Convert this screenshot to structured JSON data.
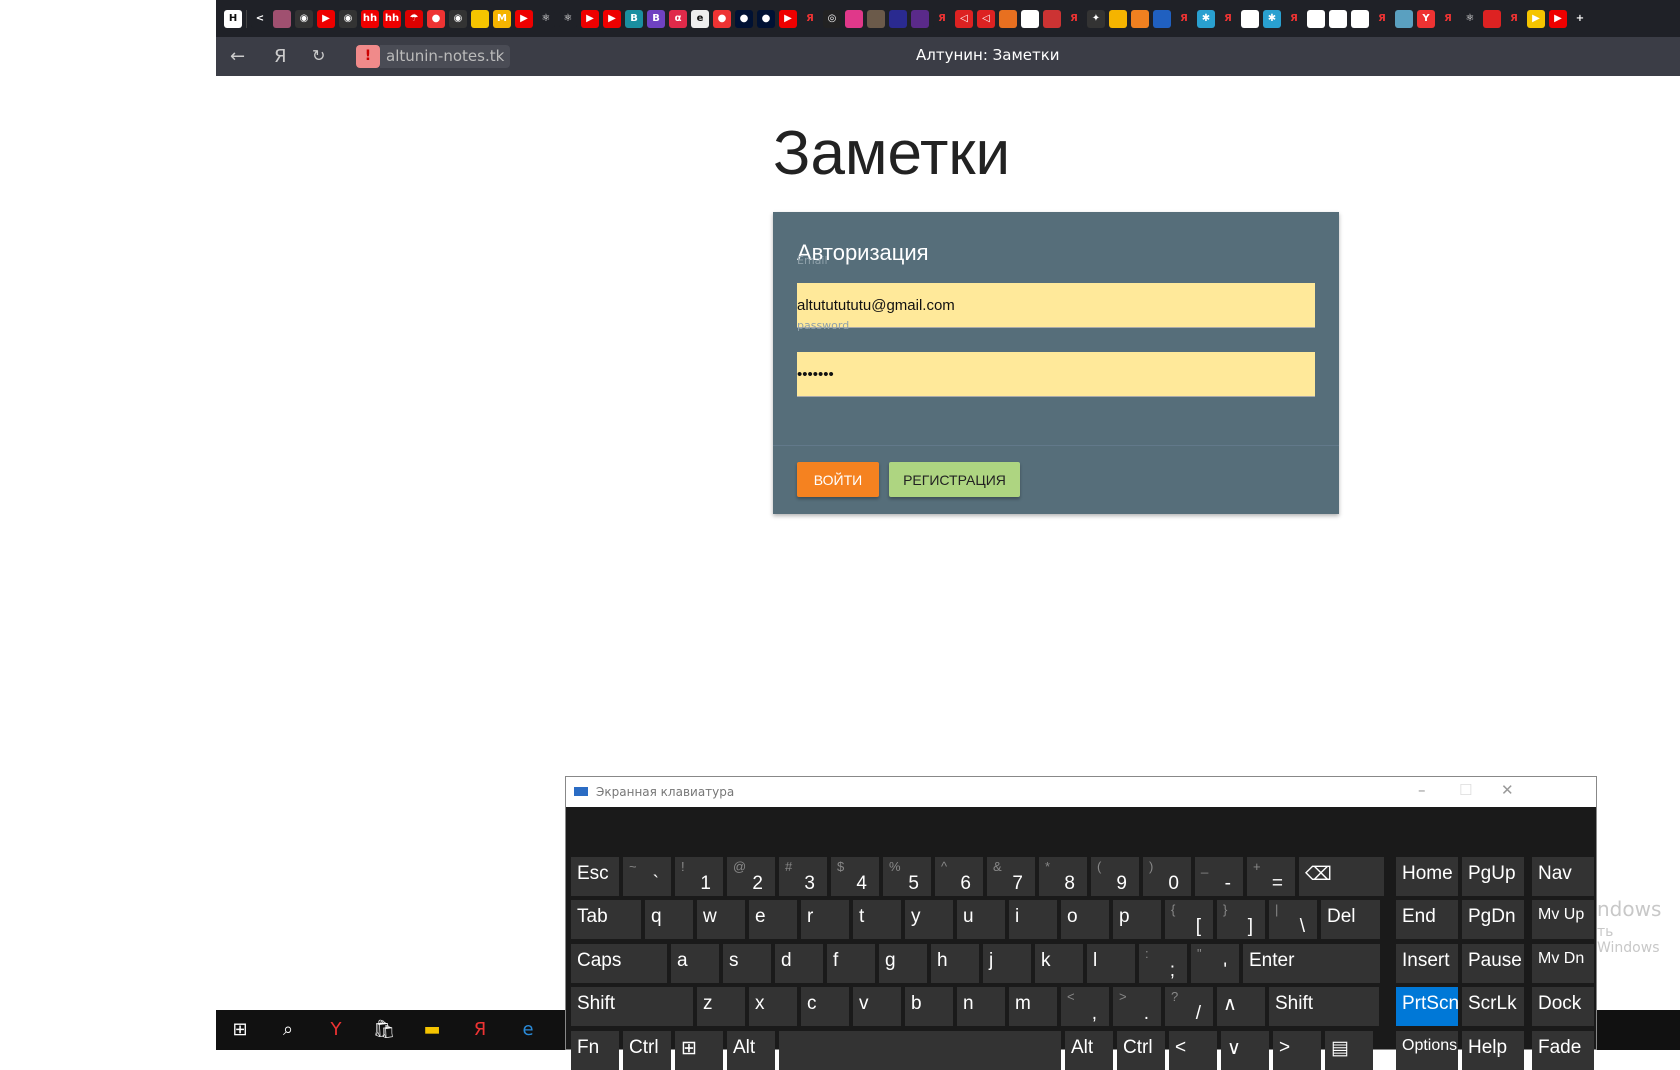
{
  "browser": {
    "tabs": [
      {
        "icon": "h-logo",
        "color": "#ffffff",
        "text": "H"
      },
      {
        "icon": "back-arrow",
        "color": "#1f2127",
        "text": "<"
      },
      {
        "icon": "soundwave",
        "color": "#a05070",
        "text": ""
      },
      {
        "icon": "github",
        "color": "#333",
        "text": "◉"
      },
      {
        "icon": "youtube",
        "color": "#e00",
        "text": "▶"
      },
      {
        "icon": "github",
        "color": "#333",
        "text": "◉"
      },
      {
        "icon": "hh",
        "color": "#e00",
        "text": "hh"
      },
      {
        "icon": "hh",
        "color": "#e00",
        "text": "hh"
      },
      {
        "icon": "umbrella",
        "color": "#d00",
        "text": "☂"
      },
      {
        "icon": "map-pin",
        "color": "#e33",
        "text": "●"
      },
      {
        "icon": "github",
        "color": "#333",
        "text": "◉"
      },
      {
        "icon": "yellow-doc",
        "color": "#f5c400",
        "text": ""
      },
      {
        "icon": "gmail",
        "color": "#f5b400",
        "text": "M"
      },
      {
        "icon": "youtube",
        "color": "#e00",
        "text": "▶"
      },
      {
        "icon": "react",
        "color": "#1f2127",
        "text": "⚛"
      },
      {
        "icon": "react",
        "color": "#1f2127",
        "text": "⚛"
      },
      {
        "icon": "youtube",
        "color": "#e00",
        "text": "▶"
      },
      {
        "icon": "youtube",
        "color": "#e00",
        "text": "▶"
      },
      {
        "icon": "react-b",
        "color": "#1a8fa0",
        "text": "B"
      },
      {
        "icon": "bootstrap",
        "color": "#6f42c1",
        "text": "B"
      },
      {
        "icon": "alpha",
        "color": "#e02a4a",
        "text": "α"
      },
      {
        "icon": "pdf",
        "color": "#eee",
        "text": "e"
      },
      {
        "icon": "map-pin",
        "color": "#e33",
        "text": "●"
      },
      {
        "icon": "pin-blue",
        "color": "#013",
        "text": "●"
      },
      {
        "icon": "pin-blue",
        "color": "#013",
        "text": "●"
      },
      {
        "icon": "youtube",
        "color": "#e00",
        "text": "▶"
      },
      {
        "icon": "yandex",
        "color": "#1f2127",
        "text": "Я"
      },
      {
        "icon": "target",
        "color": "#222",
        "text": "◎"
      },
      {
        "icon": "pink-dot",
        "color": "#e0388a",
        "text": ""
      },
      {
        "icon": "cube",
        "color": "#6b5a4a",
        "text": ""
      },
      {
        "icon": "circle-blue",
        "color": "#2a2a90",
        "text": ""
      },
      {
        "icon": "maff",
        "color": "#5a2a8a",
        "text": ""
      },
      {
        "icon": "yandex",
        "color": "#1f2127",
        "text": "Я"
      },
      {
        "icon": "triangle-red",
        "color": "#d22",
        "text": "◁"
      },
      {
        "icon": "triangle-red",
        "color": "#d22",
        "text": "◁"
      },
      {
        "icon": "fox",
        "color": "#e87020",
        "text": ""
      },
      {
        "icon": "doc",
        "color": "#fff",
        "text": ""
      },
      {
        "icon": "rocket",
        "color": "#c33",
        "text": ""
      },
      {
        "icon": "yandex",
        "color": "#1f2127",
        "text": "Я"
      },
      {
        "icon": "sparkle",
        "color": "#333",
        "text": "✦"
      },
      {
        "icon": "chart",
        "color": "#f5b400",
        "text": ""
      },
      {
        "icon": "ok",
        "color": "#f08020",
        "text": ""
      },
      {
        "icon": "wave",
        "color": "#2060c0",
        "text": ""
      },
      {
        "icon": "yandex",
        "color": "#1f2127",
        "text": "Я"
      },
      {
        "icon": "snowflake",
        "color": "#29a0d0",
        "text": "✱"
      },
      {
        "icon": "yandex",
        "color": "#1f2127",
        "text": "Я"
      },
      {
        "icon": "pause",
        "color": "#fff",
        "text": ""
      },
      {
        "icon": "snowflake",
        "color": "#29a0d0",
        "text": "✱"
      },
      {
        "icon": "yandex",
        "color": "#1f2127",
        "text": "Я"
      },
      {
        "icon": "doc",
        "color": "#fff",
        "text": ""
      },
      {
        "icon": "doc",
        "color": "#fff",
        "text": ""
      },
      {
        "icon": "white-circle",
        "color": "#fff",
        "text": ""
      },
      {
        "icon": "yandex",
        "color": "#1f2127",
        "text": "Я"
      },
      {
        "icon": "soundwave",
        "color": "#5aa0c0",
        "text": ""
      },
      {
        "icon": "yandex-browser",
        "color": "#e33",
        "text": "Y"
      },
      {
        "icon": "yandex",
        "color": "#1f2127",
        "text": "Я"
      },
      {
        "icon": "react",
        "color": "#1f2127",
        "text": "⚛"
      },
      {
        "icon": "red-book",
        "color": "#d22",
        "text": ""
      },
      {
        "icon": "yandex",
        "color": "#1f2127",
        "text": "Я"
      },
      {
        "icon": "play-yellow",
        "color": "#f5c400",
        "text": "▶"
      },
      {
        "icon": "youtube",
        "color": "#e00",
        "text": "▶"
      },
      {
        "icon": "new-tab-plus",
        "color": "#1f2127",
        "text": "+"
      }
    ],
    "url": "altunin-notes.tk",
    "page_title": "Алтунин: Заметки",
    "warning_icon": "!"
  },
  "page": {
    "title": "Заметки",
    "card": {
      "heading": "Авторизация",
      "email_label": "Email",
      "email_value": "altututututu@gmail.com",
      "password_label": "password",
      "password_value": "1234567",
      "login_button": "ВОЙТИ",
      "register_button": "РЕГИСТРАЦИЯ"
    }
  },
  "osk": {
    "title": "Экранная клавиатура",
    "rows": [
      [
        [
          "Esc",
          ""
        ],
        [
          "`",
          "~"
        ],
        [
          "1",
          "!"
        ],
        [
          "2",
          "@"
        ],
        [
          "3",
          "#"
        ],
        [
          "4",
          "$"
        ],
        [
          "5",
          "%"
        ],
        [
          "6",
          "^"
        ],
        [
          "7",
          "&"
        ],
        [
          "8",
          "*"
        ],
        [
          "9",
          "("
        ],
        [
          "0",
          ")"
        ],
        [
          "-",
          "_"
        ],
        [
          "=",
          "+"
        ],
        [
          "⌫",
          ""
        ]
      ],
      [
        [
          "Tab",
          ""
        ],
        [
          "q",
          ""
        ],
        [
          "w",
          ""
        ],
        [
          "e",
          ""
        ],
        [
          "r",
          ""
        ],
        [
          "t",
          ""
        ],
        [
          "y",
          ""
        ],
        [
          "u",
          ""
        ],
        [
          "i",
          ""
        ],
        [
          "o",
          ""
        ],
        [
          "p",
          ""
        ],
        [
          "[",
          "{"
        ],
        [
          "]",
          "}"
        ],
        [
          "\\",
          "|"
        ],
        [
          "Del",
          ""
        ]
      ],
      [
        [
          "Caps",
          ""
        ],
        [
          "a",
          ""
        ],
        [
          "s",
          ""
        ],
        [
          "d",
          ""
        ],
        [
          "f",
          ""
        ],
        [
          "g",
          ""
        ],
        [
          "h",
          ""
        ],
        [
          "j",
          ""
        ],
        [
          "k",
          ""
        ],
        [
          "l",
          ""
        ],
        [
          ";",
          ":"
        ],
        [
          "'",
          "\""
        ],
        [
          "Enter",
          ""
        ]
      ],
      [
        [
          "Shift",
          ""
        ],
        [
          "z",
          ""
        ],
        [
          "x",
          ""
        ],
        [
          "c",
          ""
        ],
        [
          "v",
          ""
        ],
        [
          "b",
          ""
        ],
        [
          "n",
          ""
        ],
        [
          "m",
          ""
        ],
        [
          ",",
          "<"
        ],
        [
          ".",
          ">"
        ],
        [
          "/",
          "?"
        ],
        [
          "∧",
          ""
        ],
        [
          "Shift",
          ""
        ]
      ],
      [
        [
          "Fn",
          ""
        ],
        [
          "Ctrl",
          ""
        ],
        [
          "⊞",
          ""
        ],
        [
          "Alt",
          ""
        ],
        [
          "",
          ""
        ],
        [
          "Alt",
          ""
        ],
        [
          "Ctrl",
          ""
        ],
        [
          "<",
          ""
        ],
        [
          "∨",
          ""
        ],
        [
          ">",
          ""
        ],
        [
          "▤",
          ""
        ]
      ]
    ],
    "nav": [
      [
        "Home",
        "PgUp",
        "Nav"
      ],
      [
        "End",
        "PgDn",
        "Mv Up"
      ],
      [
        "Insert",
        "Pause",
        "Mv Dn"
      ],
      [
        "PrtScn",
        "ScrLk",
        "Dock"
      ],
      [
        "Options",
        "Help",
        "Fade"
      ]
    ],
    "highlighted_key": "PrtScn",
    "highlight_color": "#0078d7"
  },
  "watermark": {
    "line1": "ndows",
    "line2": "ть Windows"
  },
  "taskbar": {
    "icons": [
      "start-icon",
      "search-icon",
      "yandex-browser-icon",
      "store-icon",
      "explorer-icon",
      "yandex-icon",
      "edge-icon"
    ]
  }
}
